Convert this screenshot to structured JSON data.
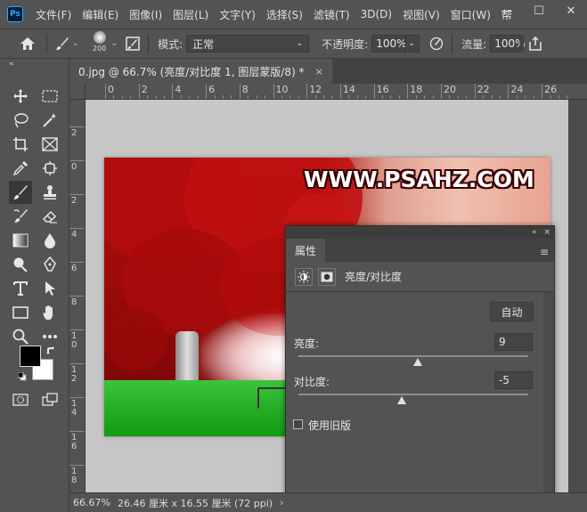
{
  "app": {
    "logo": "Ps"
  },
  "menubar": {
    "items": [
      "文件(F)",
      "编辑(E)",
      "图像(I)",
      "图层(L)",
      "文字(Y)",
      "选择(S)",
      "滤镜(T)",
      "3D(D)",
      "视图(V)",
      "窗口(W)",
      "帮"
    ],
    "window_controls": {
      "minimize": "—",
      "maximize": "☐",
      "close": "✕"
    }
  },
  "optionsbar": {
    "home_icon": "home-icon",
    "brush_size": "200",
    "mode_label": "模式:",
    "mode_value": "正常",
    "opacity_label": "不透明度:",
    "opacity_value": "100%",
    "flow_label": "流量:",
    "flow_value": "100%"
  },
  "toolbar": {
    "collapse": "«"
  },
  "document": {
    "tab_title": "0.jpg @ 66.7% (亮度/对比度 1, 图层蒙版/8) *",
    "close": "×"
  },
  "ruler": {
    "h_labels": [
      "0",
      "2",
      "4",
      "6",
      "8",
      "10",
      "12",
      "14",
      "16",
      "18",
      "20",
      "22",
      "24",
      "26"
    ],
    "v_labels": [
      "2",
      "0",
      "2",
      "4",
      "6",
      "8",
      "1\n0",
      "1\n2",
      "1\n4",
      "1\n6",
      "1\n8"
    ]
  },
  "canvas": {
    "watermark": "WWW.PSAHZ.COM"
  },
  "properties": {
    "tab": "属性",
    "collapse": "«",
    "close": "×",
    "menu_icon": "≡",
    "adjustment_title": "亮度/对比度",
    "auto_label": "自动",
    "brightness_label": "亮度:",
    "brightness_value": "9",
    "brightness_fraction": 0.52,
    "contrast_label": "对比度:",
    "contrast_value": "-5",
    "contrast_fraction": 0.45,
    "legacy_label": "使用旧版",
    "legacy_checked": false
  },
  "statusbar": {
    "zoom": "66.67%",
    "info": "26.46 厘米 x 16.55 厘米 (72 ppi)",
    "arrow": "›"
  }
}
